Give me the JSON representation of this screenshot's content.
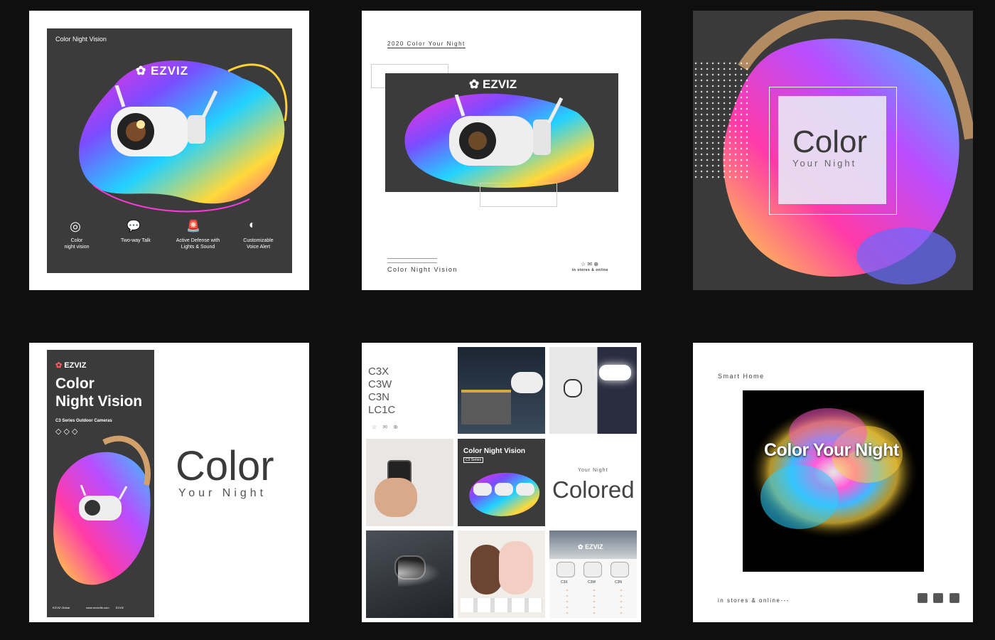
{
  "p1": {
    "title": "Color Night Vision",
    "brand": "EZVIZ",
    "features": [
      {
        "label": "Color\nnight vision",
        "icon": "aperture-icon"
      },
      {
        "label": "Two-way Talk",
        "icon": "chat-bubbles-icon"
      },
      {
        "label": "Active Defense with\nLights & Sound",
        "icon": "siren-icon"
      },
      {
        "label": "Customizable\nVoice Alert",
        "icon": "voice-head-icon"
      }
    ]
  },
  "p2": {
    "top": "2020 Color Your Night",
    "brand": "EZVIZ",
    "bottom": "Color Night Vision",
    "footer": "in stores & online"
  },
  "p3": {
    "big": "Color",
    "small": "Your Night"
  },
  "p4": {
    "brand": "EZVIZ",
    "heading1": "Color",
    "heading2": "Night Vision",
    "series": "C3 Series Outdoor Cameras",
    "footer_left": "EZVIZ Global",
    "footer_mid": "www.ezvizlife.com",
    "footer_right": "EZVIZ",
    "big": "Color",
    "small": "Your Night"
  },
  "p5": {
    "models": [
      "C3X",
      "C3W",
      "C3N",
      "LC1C"
    ],
    "card_title": "Color Night Vision",
    "card_sub": "C3 Series",
    "colored_small": "Your Night",
    "colored_big": "Colored",
    "brand": "EZVIZ",
    "table_cols": [
      "C3X",
      "C3W",
      "C3N"
    ]
  },
  "p6": {
    "top": "Smart Home",
    "center": "Color Your Night",
    "bottom": "in stores & online---"
  },
  "colors": {
    "bg": "#0f0f0f",
    "dark": "#3a3a3a",
    "accent": "#ff3ad9"
  }
}
